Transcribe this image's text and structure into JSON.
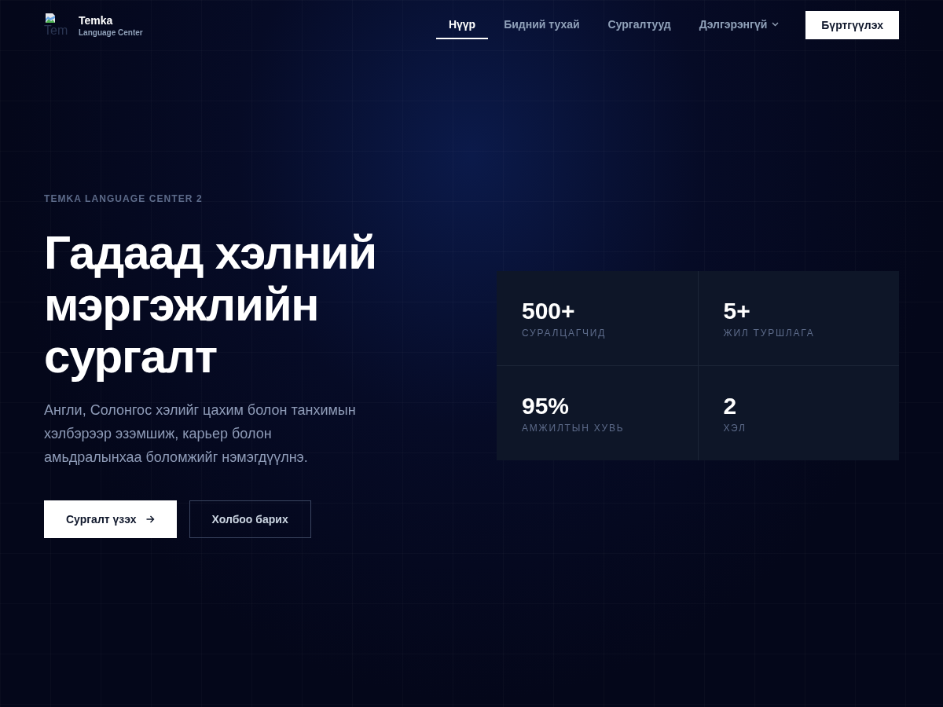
{
  "brand": {
    "logo_alt": "Tem",
    "name": "Temka",
    "tagline": "Language Center"
  },
  "nav": {
    "items": [
      {
        "label": "Нүүр",
        "selected": true,
        "kind": "link"
      },
      {
        "label": "Бидний тухай",
        "selected": false,
        "kind": "link"
      },
      {
        "label": "Сургалтууд",
        "selected": false,
        "kind": "link"
      },
      {
        "label": "Дэлгэрэнгүй",
        "selected": false,
        "kind": "dropdown"
      }
    ],
    "cta": "Бүртгүүлэх"
  },
  "hero": {
    "eyebrow": "TEMKA LANGUAGE CENTER 2",
    "heading": "Гадаад хэлний мэргэжлийн сургалт",
    "description": "Англи, Солонгос хэлийг цахим болон танхимын хэлбэрээр эзэмшиж, карьер болон амьдралынхаа боломжийг нэмэгдүүлнэ.",
    "buttons": [
      {
        "label": "Сургалт үзэх",
        "kind": "primary"
      },
      {
        "label": "Холбоо барих",
        "kind": "secondary"
      }
    ]
  },
  "stats": [
    {
      "value": "500+",
      "label": "СУРАЛЦАГЧИД"
    },
    {
      "value": "5+",
      "label": "ЖИЛ ТУРШЛАГА"
    },
    {
      "value": "95%",
      "label": "АМЖИЛТЫН ХУВЬ"
    },
    {
      "value": "2",
      "label": "ХЭЛ"
    }
  ]
}
